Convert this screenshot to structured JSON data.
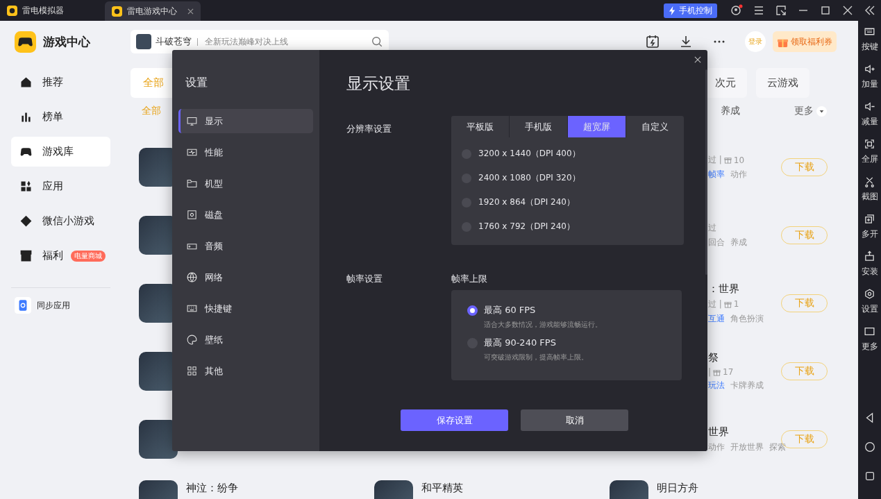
{
  "title_bar": {
    "tabs": [
      {
        "label": "雷电模拟器",
        "selected": false,
        "closable": false
      },
      {
        "label": "雷电游戏中心",
        "selected": true,
        "closable": true
      }
    ],
    "phone_control": "手机控制"
  },
  "sidebar": {
    "app_name": "游戏中心",
    "items": [
      {
        "label": "推荐",
        "selected": false
      },
      {
        "label": "榜单",
        "selected": false
      },
      {
        "label": "游戏库",
        "selected": true
      },
      {
        "label": "应用",
        "selected": false
      },
      {
        "label": "微信小游戏",
        "selected": false
      },
      {
        "label": "福利",
        "selected": false,
        "badge": "电量商城"
      }
    ],
    "sync": "同步应用"
  },
  "header": {
    "search": {
      "game": "斗破苍穹",
      "placeholder": "全新玩法巅峰对决上线"
    },
    "login": "登录",
    "coupon": "领取福利券"
  },
  "categories": [
    {
      "label": "全部",
      "selected": true
    },
    {
      "label": "次元",
      "selected": false
    },
    {
      "label": "云游戏",
      "selected": false
    }
  ],
  "filters": [
    {
      "label": "全部",
      "selected": true
    },
    {
      "label": "养成",
      "selected": false
    }
  ],
  "more": "更多",
  "game_rows": [
    {
      "meta": "过 |",
      "gifts": "10",
      "tags": [
        {
          "label": "帧率",
          "highlight": true
        },
        {
          "label": "动作",
          "highlight": false
        }
      ],
      "download": "下载"
    },
    {
      "meta": "过",
      "tags": [
        {
          "label": "回合",
          "highlight": false
        },
        {
          "label": "养成",
          "highlight": false
        }
      ],
      "download": "下载"
    },
    {
      "title": "：世界",
      "meta": "过 |",
      "gifts": "1",
      "tags": [
        {
          "label": "互通",
          "highlight": true
        },
        {
          "label": "角色扮演",
          "highlight": false
        }
      ],
      "download": "下载"
    },
    {
      "title": "祭",
      "meta": "|",
      "gifts": "17",
      "tags": [
        {
          "label": "玩法",
          "highlight": true
        },
        {
          "label": "卡牌养成",
          "highlight": false
        }
      ],
      "download": "下载"
    },
    {
      "title": "世界",
      "tags": [
        {
          "label": "动作",
          "highlight": false
        },
        {
          "label": "开放世界",
          "highlight": false
        },
        {
          "label": "探索",
          "highlight": false
        }
      ],
      "download": "下载"
    }
  ],
  "bottom_games": [
    {
      "title": "神泣：纷争"
    },
    {
      "title": "和平精英"
    },
    {
      "title": "明日方舟"
    }
  ],
  "settings": {
    "title": "设置",
    "nav": [
      {
        "label": "显示",
        "selected": true
      },
      {
        "label": "性能",
        "selected": false
      },
      {
        "label": "机型",
        "selected": false
      },
      {
        "label": "磁盘",
        "selected": false
      },
      {
        "label": "音频",
        "selected": false
      },
      {
        "label": "网络",
        "selected": false
      },
      {
        "label": "快捷键",
        "selected": false
      },
      {
        "label": "壁纸",
        "selected": false
      },
      {
        "label": "其他",
        "selected": false
      }
    ],
    "heading": "显示设置",
    "resolution": {
      "label": "分辨率设置",
      "tabs": [
        {
          "label": "平板版",
          "selected": false
        },
        {
          "label": "手机版",
          "selected": false
        },
        {
          "label": "超宽屏",
          "selected": true
        },
        {
          "label": "自定义",
          "selected": false
        }
      ],
      "options": [
        {
          "label": "3200 x 1440（DPI 400）",
          "selected": false
        },
        {
          "label": "2400 x 1080（DPI 320）",
          "selected": false
        },
        {
          "label": "1920 x 864（DPI 240）",
          "selected": false
        },
        {
          "label": "1760 x 792（DPI 240）",
          "selected": false
        }
      ]
    },
    "frame_rate": {
      "label": "帧率设置",
      "sublabel": "帧率上限",
      "options": [
        {
          "label": "最高 60 FPS",
          "description": "适合大多数情况，游戏能够流畅运行。",
          "selected": true
        },
        {
          "label": "最高 90-240 FPS",
          "description": "可突破游戏限制，提高帧率上限。",
          "selected": false
        }
      ]
    },
    "save": "保存设置",
    "cancel": "取消"
  },
  "right_toolbar": {
    "items": [
      "按键",
      "加量",
      "减量",
      "全屏",
      "截图",
      "多开",
      "安装",
      "设置",
      "更多"
    ]
  }
}
